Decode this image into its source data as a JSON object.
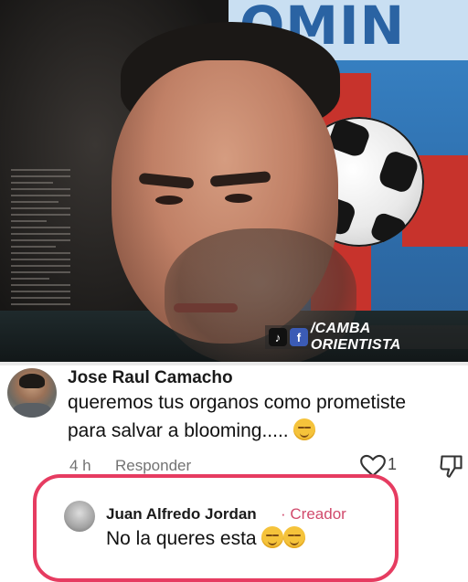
{
  "video": {
    "banner_text": "OMIN",
    "watermark_handle": "/CAMBA ORIENTISTA",
    "watermark_icons": [
      "tiktok-icon",
      "facebook-icon"
    ],
    "colors": {
      "banner": "#c9dff2",
      "banner_text": "#2a63a3",
      "red_stripe": "#c7332c",
      "blue_bg": "#2f79b9"
    }
  },
  "comment": {
    "author": "Jose Raul Camacho",
    "text_line1": "queremos tus organos como prometiste",
    "text_line2": "para salvar a blooming.....",
    "emoji": "relieved-face",
    "time": "4 h",
    "reply_label": "Responder",
    "like_count": "1"
  },
  "reply": {
    "author": "Juan Alfredo Jordan",
    "separator": "·",
    "badge": "Creador",
    "text": "No la queres esta",
    "emojis": [
      "relieved-face",
      "relieved-face"
    ],
    "highlight_color": "#e63c61"
  }
}
